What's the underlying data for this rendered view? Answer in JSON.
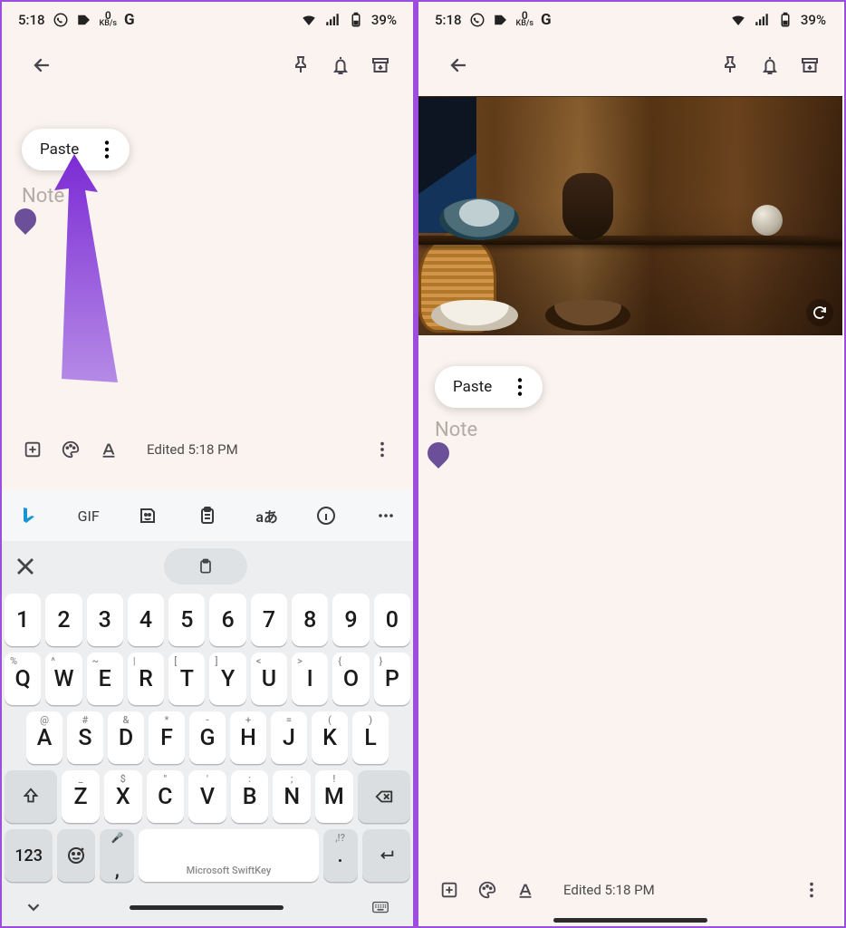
{
  "status": {
    "time": "5:18",
    "kbs_num": "0",
    "kbs_unit": "KB/s",
    "g": "G",
    "battery": "39%"
  },
  "popover": {
    "paste": "Paste"
  },
  "note": {
    "placeholder": "Note"
  },
  "bottom": {
    "edited": "Edited 5:18 PM"
  },
  "suggest": {
    "gif": "GIF",
    "trans": "aあ"
  },
  "keys": {
    "row1": [
      "1",
      "2",
      "3",
      "4",
      "5",
      "6",
      "7",
      "8",
      "9",
      "0"
    ],
    "row2": [
      "Q",
      "W",
      "E",
      "R",
      "T",
      "Y",
      "U",
      "I",
      "O",
      "P"
    ],
    "row2hint": [
      "%",
      "^",
      "~",
      "|",
      "[",
      "]",
      "<",
      ">",
      "{",
      "}"
    ],
    "row3": [
      "A",
      "S",
      "D",
      "F",
      "G",
      "H",
      "J",
      "K",
      "L"
    ],
    "row3hint": [
      "@",
      "#",
      "&",
      "*",
      "-",
      "+",
      "=",
      "(",
      ")"
    ],
    "row4": [
      "Z",
      "X",
      "C",
      "V",
      "B",
      "N",
      "M"
    ],
    "row4hint": [
      "_",
      "$",
      "\"",
      "'",
      ":",
      ";",
      "!"
    ],
    "numlbl": "123",
    "commaHint": "…",
    "dotHint": ",!?",
    "space": "Microsoft SwiftKey"
  }
}
